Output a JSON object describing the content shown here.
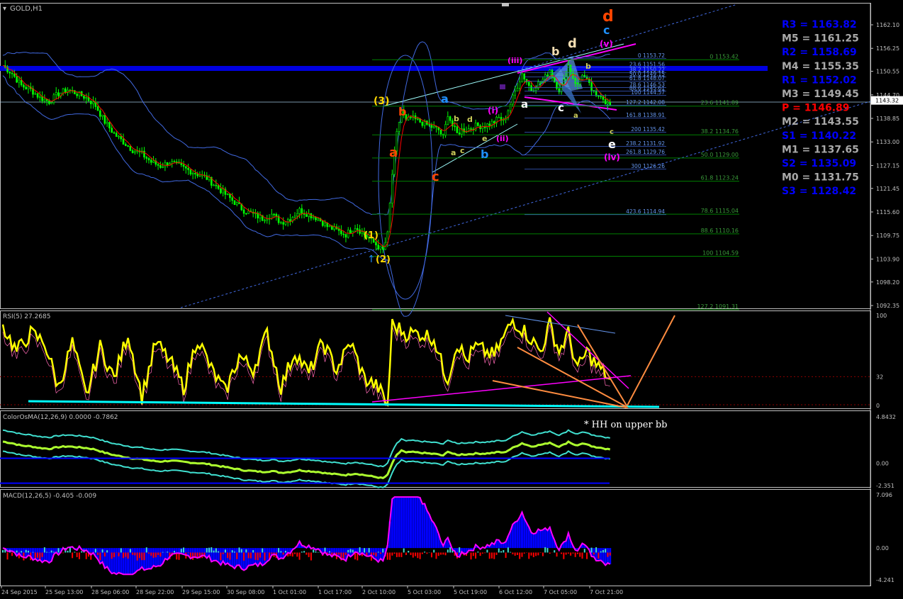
{
  "window": {
    "title": "GOLD,H1"
  },
  "colors": {
    "bg": "#000000",
    "grid_border": "#c0c0c0",
    "candle": "#00ff00",
    "bb": "#4169e1",
    "ma": "#ff0000",
    "fib": "#008000",
    "fibtext": "#3a9a3a",
    "rsi": "#ffff00",
    "osma_up": "#40e0d0",
    "macd_hist": "#0000ff",
    "macd_neg": "#ff0000",
    "pivot_blue": "#0000ff",
    "pivot_gray": "#a9a9a9",
    "pivot_red": "#ff0000",
    "magenta": "#ff00ff",
    "orange": "#ff8c40",
    "cyan": "#00ffff"
  },
  "time_axis": [
    "24 Sep 2015",
    "25 Sep 13:00",
    "28 Sep 06:00",
    "28 Sep 22:00",
    "29 Sep 15:00",
    "30 Sep 08:00",
    "1 Oct 01:00",
    "1 Oct 17:00",
    "2 Oct 10:00",
    "5 Oct 03:00",
    "5 Oct 19:00",
    "6 Oct 12:00",
    "7 Oct 05:00",
    "7 Oct 21:00"
  ],
  "price_axis": {
    "ticks": [
      "1162.10",
      "1156.25",
      "1150.55",
      "1144.70",
      "1138.85",
      "1133.00",
      "1127.15",
      "1121.45",
      "1115.60",
      "1109.75",
      "1103.90",
      "1098.20",
      "1092.35"
    ],
    "current": "1143.32"
  },
  "pivots": [
    {
      "label": "R3 = 1163.82",
      "color": "#0000ff"
    },
    {
      "label": "M5 = 1161.25",
      "color": "#a9a9a9"
    },
    {
      "label": "R2 = 1158.69",
      "color": "#0000ff"
    },
    {
      "label": "M4 = 1155.35",
      "color": "#a9a9a9"
    },
    {
      "label": "R1 = 1152.02",
      "color": "#0000ff"
    },
    {
      "label": "M3 = 1149.45",
      "color": "#a9a9a9"
    },
    {
      "label": "P  = 1146.89",
      "color": "#ff0000"
    },
    {
      "label": "M2 = 1143.55",
      "color": "#a9a9a9"
    },
    {
      "label": "S1 = 1140.22",
      "color": "#0000ff"
    },
    {
      "label": "M1 = 1137.65",
      "color": "#a9a9a9"
    },
    {
      "label": "S2 = 1135.09",
      "color": "#0000ff"
    },
    {
      "label": "M0 = 1131.75",
      "color": "#a9a9a9"
    },
    {
      "label": "S3 = 1128.42",
      "color": "#0000ff"
    }
  ],
  "fib_retracement_left": [
    {
      "label": "0 1153.42",
      "price": 1153.42
    },
    {
      "label": "23.6 1141.89",
      "price": 1141.89
    },
    {
      "label": "38.2 1134.76",
      "price": 1134.76
    },
    {
      "label": "50.0 1129.00",
      "price": 1129.0
    },
    {
      "label": "61.8 1123.24",
      "price": 1123.24
    },
    {
      "label": "78.6 1115.04",
      "price": 1115.04
    },
    {
      "label": "88.6 1110.16",
      "price": 1110.16
    },
    {
      "label": "100 1104.59",
      "price": 1104.59
    },
    {
      "label": "127.2 1091.31",
      "price": 1091.31
    }
  ],
  "fib_extension_right": [
    {
      "label": "0 1153.72",
      "price": 1153.72
    },
    {
      "label": "23.6 1151.56",
      "price": 1151.56
    },
    {
      "label": "38.2 1150.22",
      "price": 1150.22
    },
    {
      "label": "50.0 1149.15",
      "price": 1149.15
    },
    {
      "label": "61.8 1148.07",
      "price": 1148.07
    },
    {
      "label": "78.6 1146.53",
      "price": 1146.53
    },
    {
      "label": "88.6 1145.61",
      "price": 1145.61
    },
    {
      "label": "100 1144.57",
      "price": 1144.57
    },
    {
      "label": "127.2 1142.08",
      "price": 1142.08
    },
    {
      "label": "161.8 1138.91",
      "price": 1138.91
    },
    {
      "label": "200 1135.42",
      "price": 1135.42
    },
    {
      "label": "238.2 1131.92",
      "price": 1131.92
    },
    {
      "label": "261.8 1129.76",
      "price": 1129.76
    },
    {
      "label": "300 1126.26",
      "price": 1126.26
    },
    {
      "label": "423.6 1114.94",
      "price": 1114.94
    }
  ],
  "wave_labels": [
    {
      "text": "d",
      "color": "#ff4500"
    },
    {
      "text": "c",
      "color": "#1e90ff"
    },
    {
      "text": "(v)",
      "color": "#ff00ff"
    },
    {
      "text": "b",
      "color": "#f5deb3"
    },
    {
      "text": "d",
      "color": "#f5deb3"
    },
    {
      "text": "(iii)",
      "color": "#ff00ff"
    },
    {
      "text": "b",
      "color": "#cdcd5a"
    },
    {
      "text": "a",
      "color": "#1e90ff"
    },
    {
      "text": "(3)",
      "color": "#ffd700"
    },
    {
      "text": "b",
      "color": "#ff4500"
    },
    {
      "text": "a",
      "color": "#ff4500"
    },
    {
      "text": "c",
      "color": "#ff4500"
    },
    {
      "text": "b",
      "color": "#cdcd5a"
    },
    {
      "text": "d",
      "color": "#cdcd5a"
    },
    {
      "text": "(i)",
      "color": "#ff00ff"
    },
    {
      "text": "a",
      "color": "#cdcd5a"
    },
    {
      "text": "c",
      "color": "#cdcd5a"
    },
    {
      "text": "e",
      "color": "#cdcd5a"
    },
    {
      "text": "(ii)",
      "color": "#ff00ff"
    },
    {
      "text": "b",
      "color": "#1e90ff"
    },
    {
      "text": "a",
      "color": "#ffffff"
    },
    {
      "text": "c",
      "color": "#ffffff"
    },
    {
      "text": "a",
      "color": "#cdcd5a"
    },
    {
      "text": "c",
      "color": "#cdcd5a"
    },
    {
      "text": "e",
      "color": "#ffffff"
    },
    {
      "text": "(iv)",
      "color": "#ff00ff"
    },
    {
      "text": "(1)",
      "color": "#ffd700"
    },
    {
      "text": "(2)",
      "color": "#ffd700"
    }
  ],
  "rsi": {
    "title": "RSI(5) 27.2685",
    "ticks": [
      "100",
      "32",
      "0"
    ]
  },
  "osma": {
    "title": "ColorOsMA(12,26,9) 0.0000 -0.7862",
    "ticks": [
      "4.8432",
      "0.00",
      "-2.351"
    ],
    "annotation": "* HH on upper bb"
  },
  "macd": {
    "title": "MACD(12,26,5) -0.405 -0.009",
    "ticks": [
      "7.096",
      "0.00",
      "-4.241"
    ]
  },
  "chart_data": {
    "type": "candlestick",
    "symbol": "GOLD",
    "timeframe": "H1",
    "ylim": [
      1092.35,
      1164.5
    ],
    "x_ticks": [
      "24 Sep 2015",
      "25 Sep 13:00",
      "28 Sep 06:00",
      "28 Sep 22:00",
      "29 Sep 15:00",
      "30 Sep 08:00",
      "1 Oct 01:00",
      "1 Oct 17:00",
      "2 Oct 10:00",
      "5 Oct 03:00",
      "5 Oct 19:00",
      "6 Oct 12:00",
      "7 Oct 05:00",
      "7 Oct 21:00"
    ],
    "close_path": [
      [
        0,
        1152
      ],
      [
        4,
        1150
      ],
      [
        8,
        1147
      ],
      [
        12,
        1146
      ],
      [
        16,
        1144
      ],
      [
        20,
        1143
      ],
      [
        24,
        1145
      ],
      [
        28,
        1146
      ],
      [
        32,
        1145
      ],
      [
        36,
        1144
      ],
      [
        40,
        1142
      ],
      [
        44,
        1138
      ],
      [
        48,
        1135
      ],
      [
        52,
        1133
      ],
      [
        56,
        1131
      ],
      [
        60,
        1130
      ],
      [
        64,
        1128
      ],
      [
        68,
        1127
      ],
      [
        72,
        1128
      ],
      [
        76,
        1127
      ],
      [
        80,
        1126
      ],
      [
        84,
        1125
      ],
      [
        88,
        1124
      ],
      [
        92,
        1122
      ],
      [
        96,
        1120
      ],
      [
        100,
        1118
      ],
      [
        104,
        1116
      ],
      [
        108,
        1115
      ],
      [
        112,
        1114
      ],
      [
        116,
        1115
      ],
      [
        120,
        1113
      ],
      [
        124,
        1114
      ],
      [
        128,
        1116
      ],
      [
        132,
        1115
      ],
      [
        136,
        1114
      ],
      [
        140,
        1112
      ],
      [
        144,
        1111
      ],
      [
        148,
        1110
      ],
      [
        152,
        1112
      ],
      [
        156,
        1110
      ],
      [
        160,
        1108
      ],
      [
        164,
        1106
      ],
      [
        166,
        1110
      ],
      [
        168,
        1125
      ],
      [
        170,
        1135
      ],
      [
        172,
        1141
      ],
      [
        174,
        1138
      ],
      [
        176,
        1139
      ],
      [
        180,
        1138
      ],
      [
        184,
        1137
      ],
      [
        188,
        1136
      ],
      [
        190,
        1134
      ],
      [
        192,
        1140
      ],
      [
        194,
        1137
      ],
      [
        196,
        1135
      ],
      [
        198,
        1136
      ],
      [
        200,
        1136
      ],
      [
        204,
        1137
      ],
      [
        208,
        1137
      ],
      [
        212,
        1138
      ],
      [
        214,
        1139
      ],
      [
        216,
        1138
      ],
      [
        218,
        1141
      ],
      [
        220,
        1144
      ],
      [
        222,
        1147
      ],
      [
        224,
        1150
      ],
      [
        226,
        1148
      ],
      [
        228,
        1146
      ],
      [
        230,
        1147
      ],
      [
        232,
        1148
      ],
      [
        234,
        1149
      ],
      [
        236,
        1151
      ],
      [
        238,
        1148
      ],
      [
        240,
        1146
      ],
      [
        242,
        1148
      ],
      [
        244,
        1152
      ],
      [
        246,
        1149
      ],
      [
        248,
        1147
      ],
      [
        250,
        1150
      ],
      [
        252,
        1148
      ],
      [
        254,
        1146
      ],
      [
        256,
        1144
      ],
      [
        258,
        1145
      ],
      [
        260,
        1143
      ],
      [
        262,
        1142
      ]
    ],
    "rsi_path": [
      [
        0,
        88
      ],
      [
        6,
        60
      ],
      [
        12,
        80
      ],
      [
        18,
        70
      ],
      [
        24,
        20
      ],
      [
        30,
        70
      ],
      [
        36,
        10
      ],
      [
        42,
        65
      ],
      [
        48,
        30
      ],
      [
        54,
        80
      ],
      [
        60,
        10
      ],
      [
        66,
        70
      ],
      [
        72,
        50
      ],
      [
        78,
        20
      ],
      [
        84,
        75
      ],
      [
        90,
        40
      ],
      [
        96,
        15
      ],
      [
        102,
        55
      ],
      [
        108,
        40
      ],
      [
        114,
        80
      ],
      [
        120,
        20
      ],
      [
        126,
        60
      ],
      [
        132,
        35
      ],
      [
        138,
        70
      ],
      [
        144,
        40
      ],
      [
        150,
        70
      ],
      [
        156,
        30
      ],
      [
        162,
        20
      ],
      [
        166,
        0
      ],
      [
        168,
        90
      ],
      [
        174,
        80
      ],
      [
        180,
        80
      ],
      [
        186,
        75
      ],
      [
        190,
        40
      ],
      [
        192,
        30
      ],
      [
        196,
        70
      ],
      [
        200,
        50
      ],
      [
        204,
        65
      ],
      [
        208,
        60
      ],
      [
        212,
        55
      ],
      [
        216,
        75
      ],
      [
        220,
        95
      ],
      [
        226,
        80
      ],
      [
        232,
        60
      ],
      [
        236,
        90
      ],
      [
        240,
        60
      ],
      [
        244,
        80
      ],
      [
        248,
        40
      ],
      [
        252,
        60
      ],
      [
        256,
        45
      ],
      [
        260,
        35
      ],
      [
        262,
        27
      ]
    ]
  }
}
